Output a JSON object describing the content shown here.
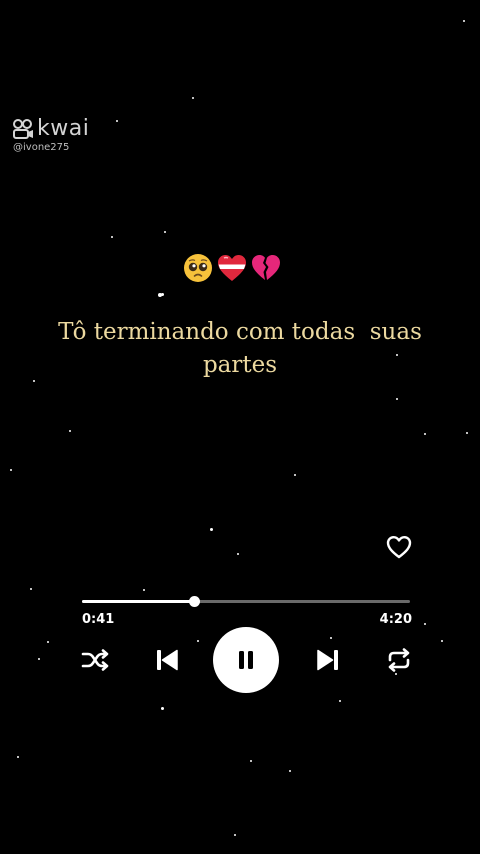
{
  "watermark": {
    "brand": "kwai",
    "handle": "@ivone275"
  },
  "emojis": [
    "pleading-face",
    "red-white-heart",
    "broken-heart"
  ],
  "lyrics": {
    "text": "Tô terminando com todas  suas\npartes"
  },
  "player": {
    "elapsed": "0:41",
    "total": "4:20",
    "progress_fraction": 0.34,
    "is_playing": true,
    "liked": false
  },
  "controls": {
    "shuffle_icon": "shuffle-icon",
    "previous_icon": "skip-previous-icon",
    "play_pause_icon": "pause-icon",
    "next_icon": "skip-next-icon",
    "repeat_icon": "repeat-icon",
    "like_icon": "heart-outline-icon"
  },
  "colors": {
    "background": "#000000",
    "lyrics": "#ecd9a0",
    "track": "#6a6a6a",
    "foreground": "#ffffff"
  }
}
